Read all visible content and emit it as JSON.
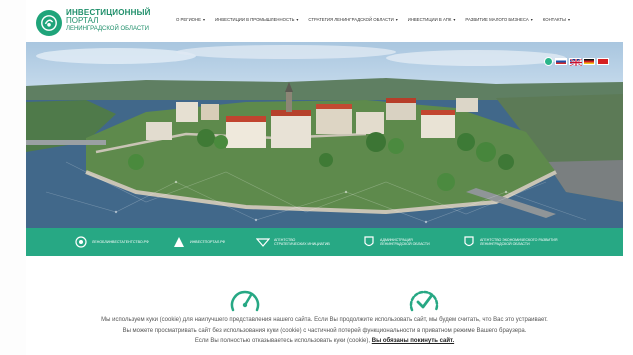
{
  "logo": {
    "line1": "ИНВЕСТИЦИОННЫЙ",
    "line2": "ПОРТАЛ",
    "line3": "ЛЕНИНГРАДСКОЙ ОБЛАСТИ"
  },
  "nav": {
    "items": [
      {
        "label": "О РЕГИОНЕ"
      },
      {
        "label": "ИНВЕСТИЦИИ В ПРОМЫШЛЕННОСТЬ"
      },
      {
        "label": "СТРАТЕГИЯ ЛЕНИНГРАДСКОЙ ОБЛАСТИ"
      },
      {
        "label": "ИНВЕСТИЦИИ В АПК"
      },
      {
        "label": "РАЗВИТИЕ МАЛОГО БИЗНЕСА"
      },
      {
        "label": "КОНТАКТЫ"
      }
    ]
  },
  "languages": {
    "flags": [
      "ru",
      "en",
      "de",
      "cn"
    ],
    "colors": {
      "ru": [
        "#ffffff",
        "#1f4fa8",
        "#d12a2a"
      ],
      "en": "#1f3a8a",
      "de": [
        "#111111",
        "#d41f1f",
        "#f2c21a"
      ],
      "cn": "#d62020"
    }
  },
  "partners": [
    {
      "text1": "ЛЕНОБЛИНВЕСТАГЕНТСТВО.РФ",
      "text2": ""
    },
    {
      "text1": "ИНВЕСТПОРТАЛ.РФ",
      "text2": ""
    },
    {
      "text1": "АГЕНТСТВО",
      "text2": "СТРАТЕГИЧЕСКИХ ИНИЦИАТИВ"
    },
    {
      "text1": "АДМИНИСТРАЦИЯ",
      "text2": "ЛЕНИНГРАДСКОЙ ОБЛАСТИ"
    },
    {
      "text1": "АГЕНТСТВО ЭКОНОМИЧЕСКОГО РАЗВИТИЯ",
      "text2": "ЛЕНИНГРАДСКОЙ ОБЛАСТИ"
    }
  ],
  "cookie": {
    "line1": "Мы используем куки (cookie) для наилучшего представления нашего сайта. Если Вы продолжите использовать сайт, мы будем считать, что Вас это устраивает.",
    "line2": "Вы можете просматривать сайт без использования куки (cookie) с частичной потерей функциональности в приватном режиме Вашего браузера.",
    "line3a": "Если Вы полностью отказываетесь использовать куки (cookie),",
    "line3b": "Вы обязаны покинуть сайт."
  },
  "colors": {
    "brand_green": "#27a884",
    "logo_green": "#1f8f6a"
  }
}
